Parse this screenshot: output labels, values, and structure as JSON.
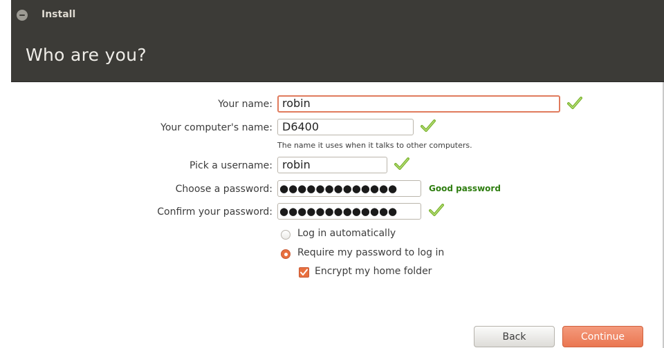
{
  "window": {
    "title": "Install",
    "page_title": "Who are you?"
  },
  "form": {
    "name": {
      "label": "Your name:",
      "value": "robin",
      "valid": true
    },
    "computer": {
      "label": "Your computer's name:",
      "value": "D6400",
      "hint": "The name it uses when it talks to other computers.",
      "valid": true
    },
    "username": {
      "label": "Pick a username:",
      "value": "robin",
      "valid": true
    },
    "password": {
      "label": "Choose a password:",
      "value": "●●●●●●●●●●●●●",
      "strength": "Good password"
    },
    "confirm": {
      "label": "Confirm your password:",
      "value": "●●●●●●●●●●●●●",
      "valid": true
    }
  },
  "login_options": {
    "auto": {
      "label": "Log in automatically",
      "selected": false
    },
    "require": {
      "label": "Require my password to log in",
      "selected": true
    },
    "encrypt": {
      "label": "Encrypt my home folder",
      "checked": true
    }
  },
  "buttons": {
    "back": "Back",
    "continue": "Continue"
  },
  "colors": {
    "header_bg": "#3c3b37",
    "accent": "#e8703f",
    "valid_check": "#7ab32e",
    "strength_text": "#2e7d10"
  },
  "icons": [
    "close-icon",
    "checkmark-icon",
    "radio-icon",
    "checkbox-icon"
  ]
}
